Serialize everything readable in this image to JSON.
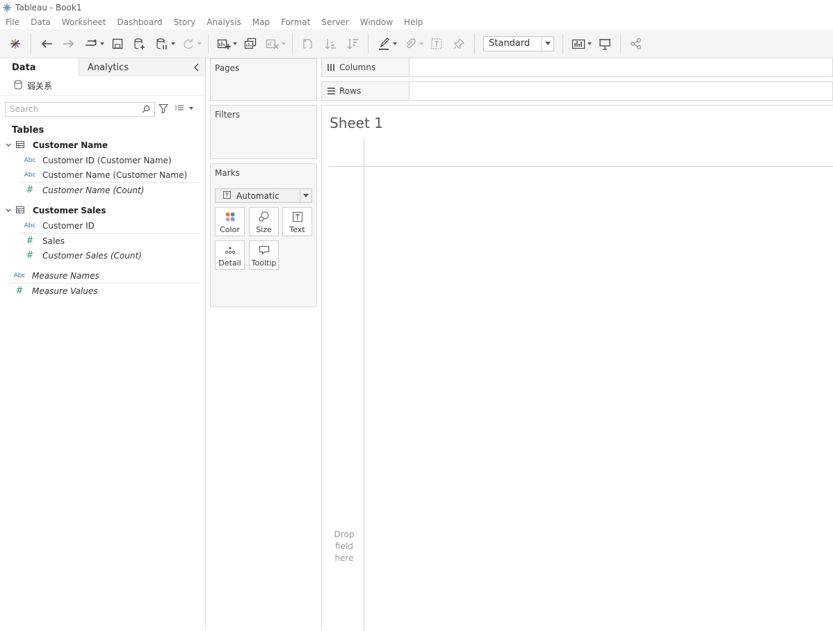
{
  "window": {
    "title": "Tableau - Book1"
  },
  "menubar": [
    "File",
    "Data",
    "Worksheet",
    "Dashboard",
    "Story",
    "Analysis",
    "Map",
    "Format",
    "Server",
    "Window",
    "Help"
  ],
  "toolbar": {
    "fit_dropdown": "Standard"
  },
  "data_pane": {
    "tab_data": "Data",
    "tab_analytics": "Analytics",
    "datasource": "弱关系",
    "search_placeholder": "Search",
    "tables_heading": "Tables",
    "tables": [
      {
        "name": "Customer Name",
        "fields": [
          {
            "type": "Abc",
            "name": "Customer ID (Customer Name)"
          },
          {
            "type": "Abc",
            "name": "Customer Name (Customer Name)"
          },
          {
            "type": "#",
            "name": "Customer Name (Count)"
          }
        ]
      },
      {
        "name": "Customer Sales",
        "fields": [
          {
            "type": "Abc",
            "name": "Customer ID"
          },
          {
            "type": "#",
            "name": "Sales"
          },
          {
            "type": "#",
            "name": "Customer Sales (Count)"
          }
        ]
      }
    ],
    "measure_fields": [
      {
        "type": "Abc",
        "name": "Measure Names"
      },
      {
        "type": "#",
        "name": "Measure Values"
      }
    ]
  },
  "cards": {
    "pages": "Pages",
    "filters": "Filters",
    "marks": "Marks",
    "mark_type": "Automatic",
    "mark_buttons": {
      "color": "Color",
      "size": "Size",
      "text": "Text",
      "detail": "Detail",
      "tooltip": "Tooltip"
    }
  },
  "shelves": {
    "columns": "Columns",
    "rows": "Rows"
  },
  "canvas": {
    "sheet_title": "Sheet 1",
    "drop_line1": "Drop",
    "drop_line2": "field",
    "drop_line3": "here"
  }
}
